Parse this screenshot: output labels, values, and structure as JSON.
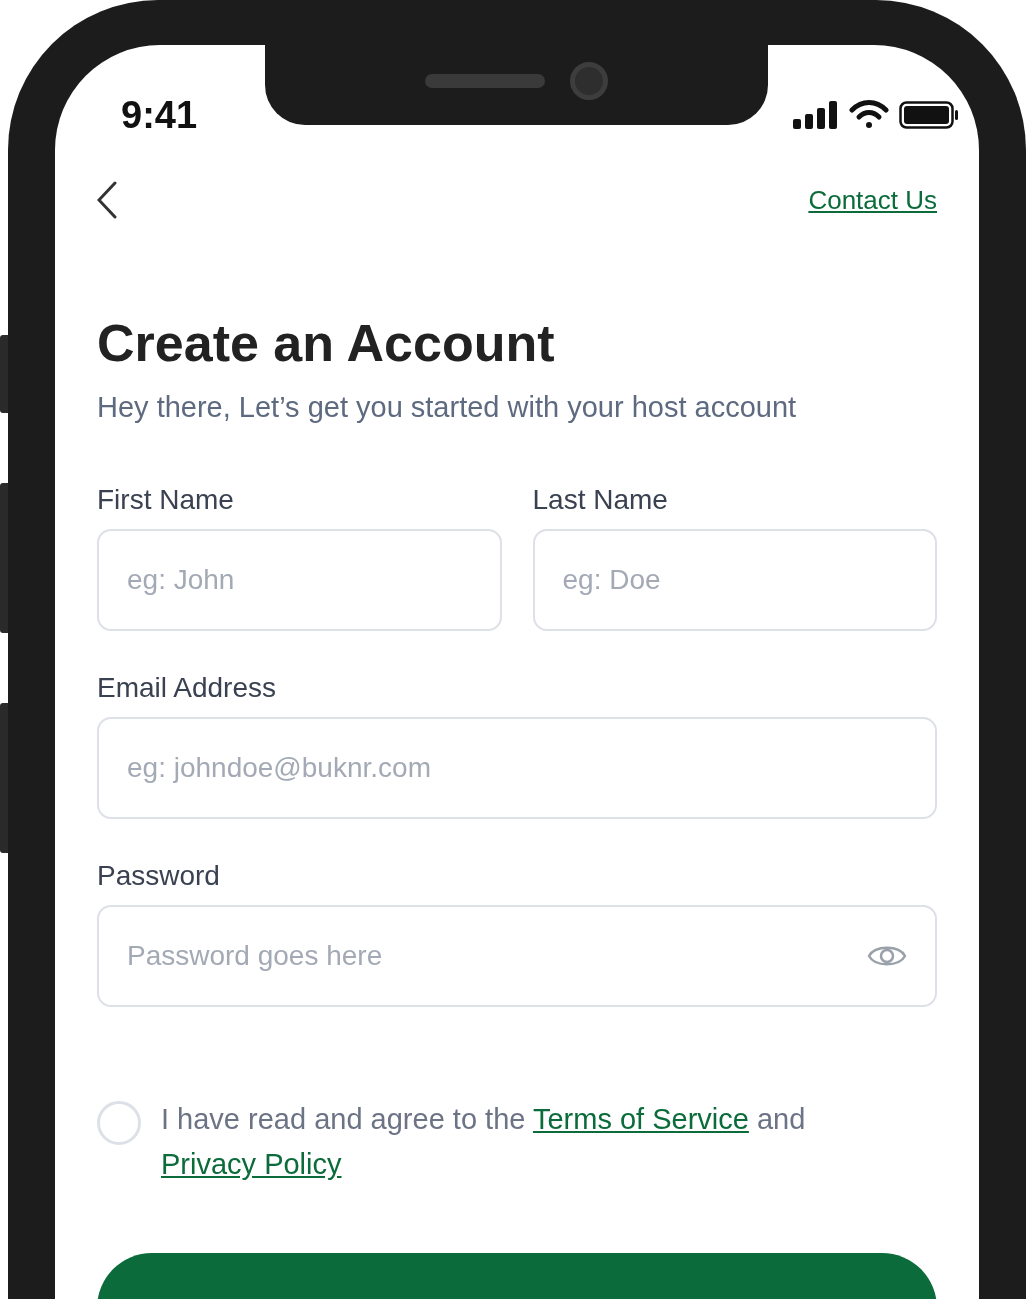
{
  "status_bar": {
    "time": "9:41"
  },
  "header": {
    "contact_link": "Contact Us"
  },
  "title": "Create an Account",
  "subtitle": "Hey there, Let’s get you started with your host account",
  "fields": [
    {
      "kind": "half",
      "label": "First Name",
      "placeholder": "eg: John"
    },
    {
      "kind": "half",
      "label": "Last Name",
      "placeholder": "eg: Doe"
    },
    {
      "kind": "full",
      "label": "Email Address",
      "placeholder": "eg: johndoe@buknr.com"
    },
    {
      "kind": "password",
      "label": "Password",
      "placeholder": "Password goes here"
    }
  ],
  "agreement": {
    "checked": false,
    "text_before": "I have read and agree to the",
    "terms_link": "Terms of Service",
    "text_middle": "and",
    "privacy_link": "Privacy Policy"
  }
}
